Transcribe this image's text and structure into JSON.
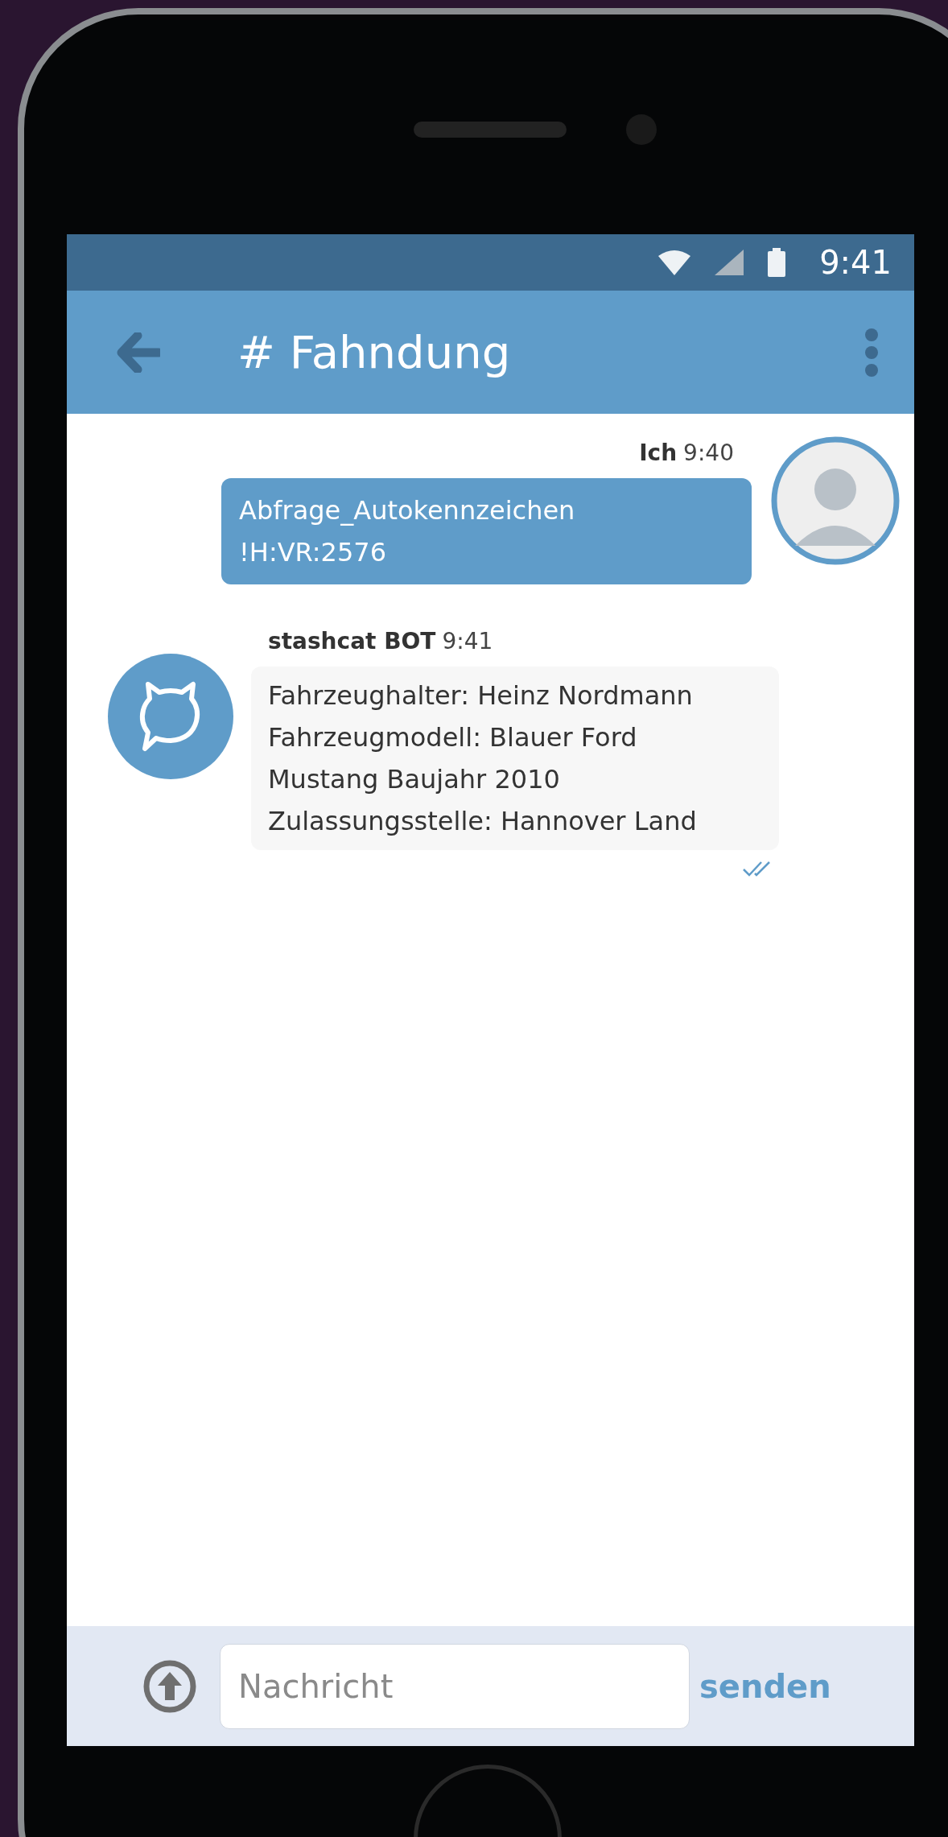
{
  "status_bar": {
    "time": "9:41"
  },
  "app_bar": {
    "title": "# Fahndung"
  },
  "messages": [
    {
      "kind": "outgoing",
      "sender": "Ich",
      "time": "9:40",
      "lines": [
        "Abfrage_Autokennzeichen",
        "!H:VR:2576"
      ]
    },
    {
      "kind": "incoming",
      "sender": "stashcat BOT",
      "time": "9:41",
      "lines": [
        "Fahrzeughalter: Heinz Nordmann",
        "Fahrzeugmodell: Blauer Ford",
        "Mustang Baujahr 2010",
        "Zulassungsstelle: Hannover Land"
      ],
      "read": true
    }
  ],
  "composer": {
    "placeholder": "Nachricht",
    "send_label": "senden"
  }
}
